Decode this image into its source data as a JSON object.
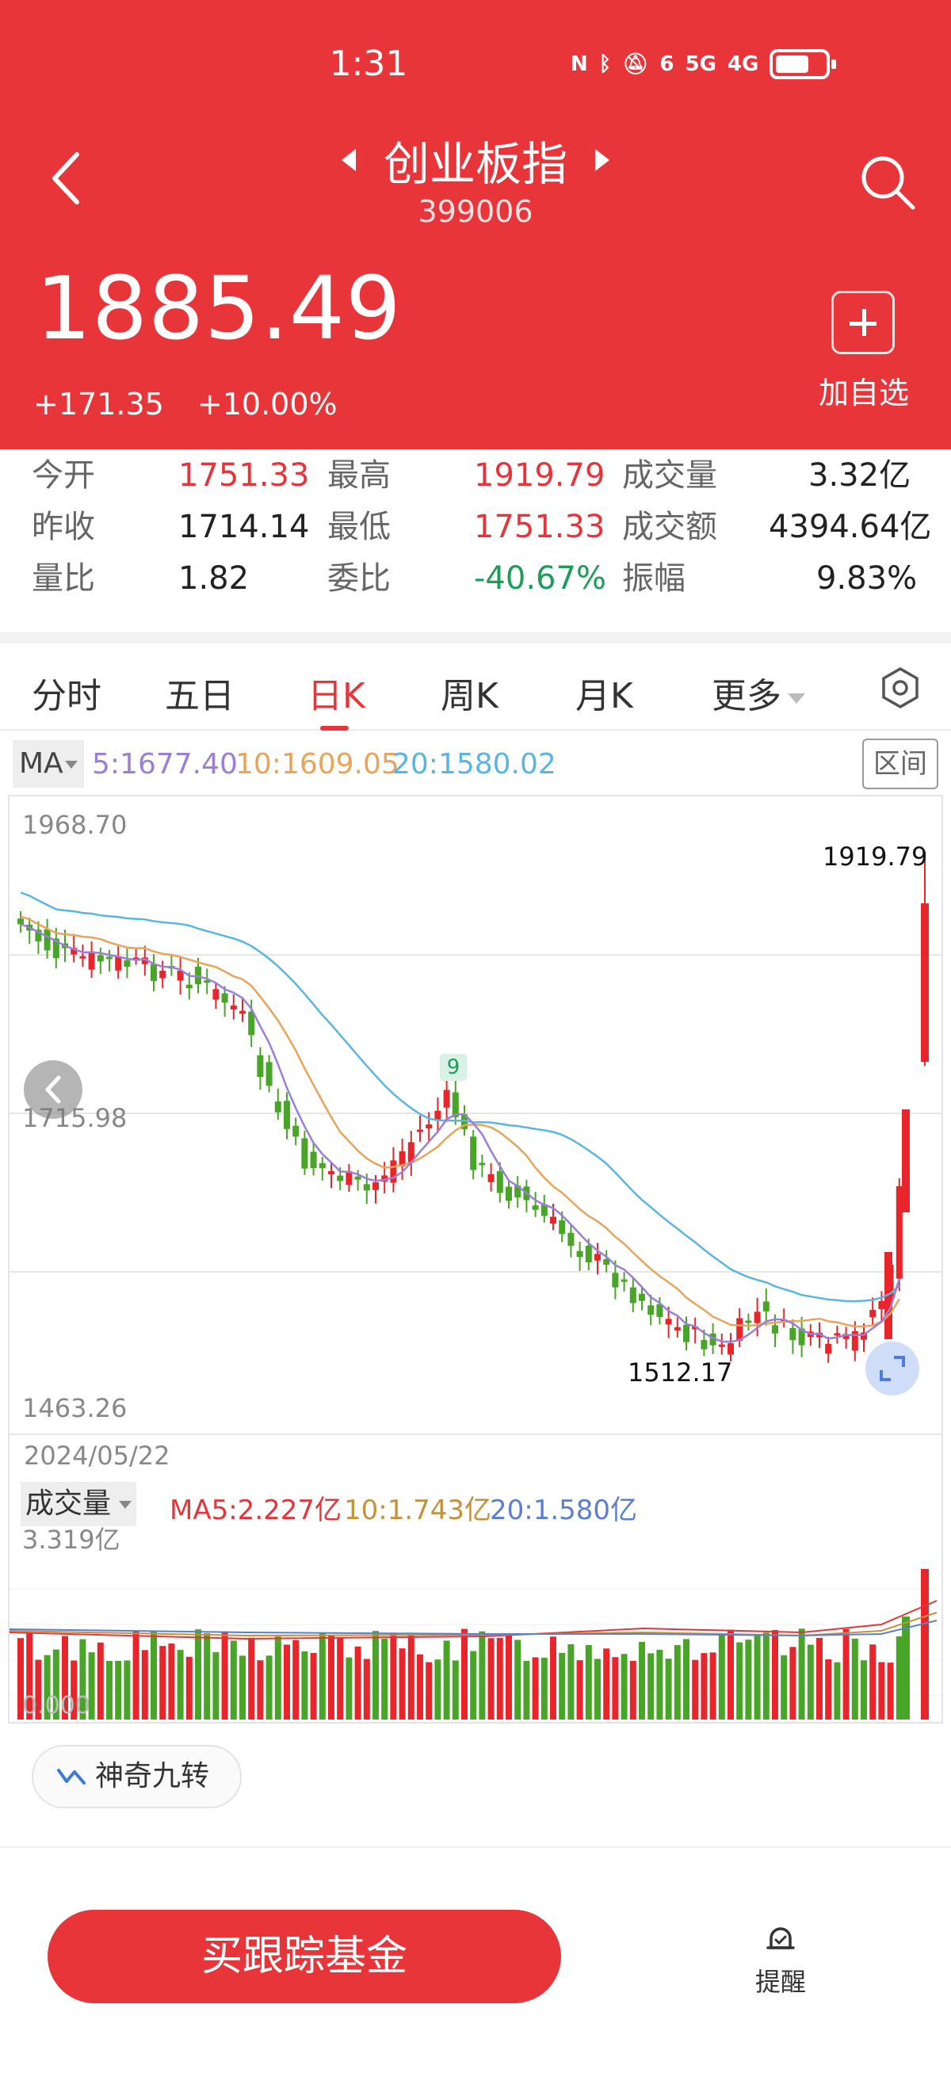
{
  "status_bar": {
    "time": "1:31",
    "net1": "6",
    "net2": "5G",
    "net3": "4G"
  },
  "header": {
    "title": "创业板指",
    "code": "399006",
    "price": "1885.49",
    "change": "+171.35",
    "change_pct": "+10.00%",
    "add_label": "加自选",
    "bg_color": "#e8353a"
  },
  "stats": [
    {
      "label": "今开",
      "value": "1751.33",
      "tone": "red"
    },
    {
      "label": "最高",
      "value": "1919.79",
      "tone": "red"
    },
    {
      "label": "成交量",
      "value": "3.32亿",
      "tone": "dark"
    },
    {
      "label": "昨收",
      "value": "1714.14",
      "tone": "dark"
    },
    {
      "label": "最低",
      "value": "1751.33",
      "tone": "red"
    },
    {
      "label": "成交额",
      "value": "4394.64亿",
      "tone": "dark"
    },
    {
      "label": "量比",
      "value": "1.82",
      "tone": "dark"
    },
    {
      "label": "委比",
      "value": "-40.67%",
      "tone": "green"
    },
    {
      "label": "振幅",
      "value": "9.83%",
      "tone": "dark"
    }
  ],
  "tabs": [
    "分时",
    "五日",
    "日K",
    "周K",
    "月K",
    "更多"
  ],
  "active_tab": "日K",
  "ma": {
    "label": "MA",
    "ma5": "5:1677.40",
    "ma10": "10:1609.05",
    "ma20": "20:1580.02",
    "range_btn": "区间",
    "colors": {
      "ma5": "#9b7fd6",
      "ma10": "#e9a45a",
      "ma20": "#5ab5e3"
    }
  },
  "chart_data": {
    "type": "candlestick",
    "y_labels": [
      "1968.70",
      "1715.98",
      "1463.26"
    ],
    "ylim": [
      1463.26,
      1968.7
    ],
    "high_label": "1919.79",
    "low_label": "1512.17",
    "start_date": "2024/05/22",
    "td_marker_top": "9",
    "up_color": "#e8252b",
    "down_color": "#49a528"
  },
  "volume": {
    "label": "成交量",
    "ma5": "MA5:2.227亿",
    "ma10": "10:1.743亿",
    "ma20": "20:1.580亿",
    "max_label": "3.319亿",
    "zero_label": "0.000"
  },
  "footer": {
    "indicator_chip": "神奇九转",
    "buy_button": "买跟踪基金",
    "remind_label": "提醒"
  }
}
